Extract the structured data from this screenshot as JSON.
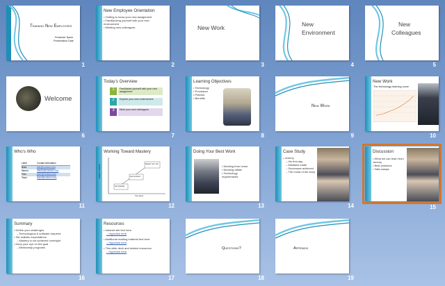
{
  "colors": {
    "accent_teal": "#1f8fb7",
    "accent_light": "#6fc6e3",
    "selection": "#d3772c"
  },
  "slides": [
    {
      "number": "1",
      "title": "Training New Employees",
      "subtitle_lines": [
        "Presenter Name",
        "Presentation Date"
      ]
    },
    {
      "number": "2",
      "title": "New Employee Orientation",
      "bullets": [
        "Getting to know your new assignment",
        "Familiarizing yourself with your new environment",
        "Meeting new colleagues"
      ]
    },
    {
      "number": "3",
      "title": "New Work"
    },
    {
      "number": "4",
      "title_lines": [
        "New",
        "Environment"
      ]
    },
    {
      "number": "5",
      "title_lines": [
        "New",
        "Colleagues"
      ]
    },
    {
      "number": "6",
      "title": "Welcome"
    },
    {
      "number": "7",
      "title": "Today’s Overview",
      "steps": [
        {
          "n": "1",
          "text": "Familiarize yourself with your new assignment"
        },
        {
          "n": "2",
          "text": "Explore your new environment"
        },
        {
          "n": "3",
          "text": "Meet your new colleagues"
        }
      ]
    },
    {
      "number": "8",
      "title": "Learning Objectives",
      "bullets": [
        "Technology",
        "Procedure",
        "Policies",
        "Benefits"
      ]
    },
    {
      "number": "9",
      "title": "New Work"
    },
    {
      "number": "10",
      "title": "New Work",
      "chart_caption": "The technology learning curve"
    },
    {
      "number": "11",
      "title": "Who’s Who",
      "table_header": [
        "Label",
        "Contact information"
      ],
      "table_rows": [
        [
          "Boss",
          "bob@contoso.com"
        ],
        [
          "Mentor",
          "mentor@contoso.com"
        ],
        [
          "Peer",
          "peer@contoso.com"
        ],
        [
          "Team",
          "team@contoso.com"
        ]
      ]
    },
    {
      "number": "12",
      "title": "Working Toward Mastery",
      "boxes": [
        "Get Familiar",
        "Get Involved",
        "Master Your Job"
      ],
      "axis_x": "Time Spent",
      "axis_y": "Mastery of Material"
    },
    {
      "number": "13",
      "title": "Doing Your Best Work",
      "bullets": [
        "Working from home",
        "Working offsite",
        "Technology requirements"
      ]
    },
    {
      "number": "14",
      "title": "Case Study",
      "bullets": [
        "Jeremy",
        "His first day",
        "Mistakes made",
        "Successes achieved",
        "The moral of the story"
      ]
    },
    {
      "number": "15",
      "title": "Discussion",
      "bullets": [
        "What we can learn from Jeremy",
        "Best practices",
        "Take-aways"
      ]
    },
    {
      "number": "16",
      "title": "Summary",
      "bullets": [
        "Define your challenges",
        "Technological & software required",
        "Set realistic expectations",
        "Mastery is not achieved overnight",
        "Keep your eye on the goal",
        "Mentorship programs"
      ]
    },
    {
      "number": "17",
      "title": "Resources",
      "bullets": [
        "Intranet site text here",
        "Hyperlink here",
        "Additional reading material text here",
        "Hyperlink here",
        "This slide deck and related resources",
        "Hyperlink here"
      ]
    },
    {
      "number": "18",
      "title": "Questions?"
    },
    {
      "number": "19",
      "title": "Appendix"
    }
  ]
}
